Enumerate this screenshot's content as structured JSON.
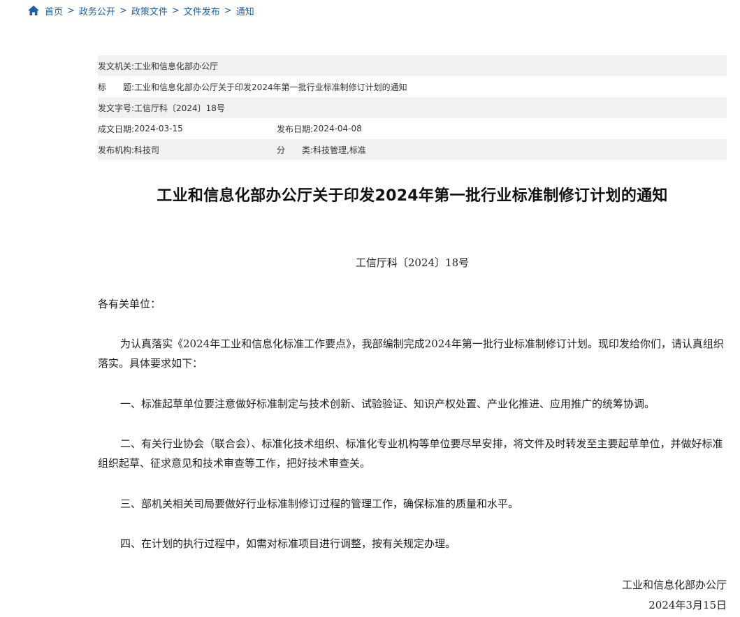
{
  "breadcrumb": {
    "items": [
      "首页",
      "政务公开",
      "政策文件",
      "文件发布",
      "通知"
    ],
    "separator": ">"
  },
  "meta": {
    "issuer_label": "发文机关:",
    "issuer": "工业和信息化部办公厅",
    "title_label": "标　　题:",
    "title": "工业和信息化部办公厅关于印发2024年第一批行业标准制修订计划的通知",
    "docno_label": "发文字号:",
    "docno": "工信厅科〔2024〕18号",
    "created_label": "成文日期:",
    "created": "2024-03-15",
    "published_label": "发布日期:",
    "published": "2024-04-08",
    "agency_label": "发布机构:",
    "agency": "科技司",
    "category_label": "分　　类:",
    "category": "科技管理,标准"
  },
  "document": {
    "title": "工业和信息化部办公厅关于印发2024年第一批行业标准制修订计划的通知",
    "doc_number": "工信厅科〔2024〕18号",
    "salutation": "各有关单位：",
    "intro": "为认真落实《2024年工业和信息化标准工作要点》，我部编制完成2024年第一批行业标准制修订计划。现印发给你们，请认真组织落实。具体要求如下：",
    "item1": "一、标准起草单位要注意做好标准制定与技术创新、试验验证、知识产权处置、产业化推进、应用推广的统筹协调。",
    "item2": "二、有关行业协会（联合会）、标准化技术组织、标准化专业机构等单位要尽早安排，将文件及时转发至主要起草单位，并做好标准组织起草、征求意见和技术审查等工作，把好技术审查关。",
    "item3": "三、部机关相关司局要做好行业标准制修订过程的管理工作，确保标准的质量和水平。",
    "item4": "四、在计划的执行过程中，如需对标准项目进行调整，按有关规定办理。",
    "signer": "工业和信息化部办公厅",
    "sign_date": "2024年3月15日"
  },
  "colors": {
    "link": "#1f5fa8",
    "row_shade": "#f1f1f1"
  }
}
